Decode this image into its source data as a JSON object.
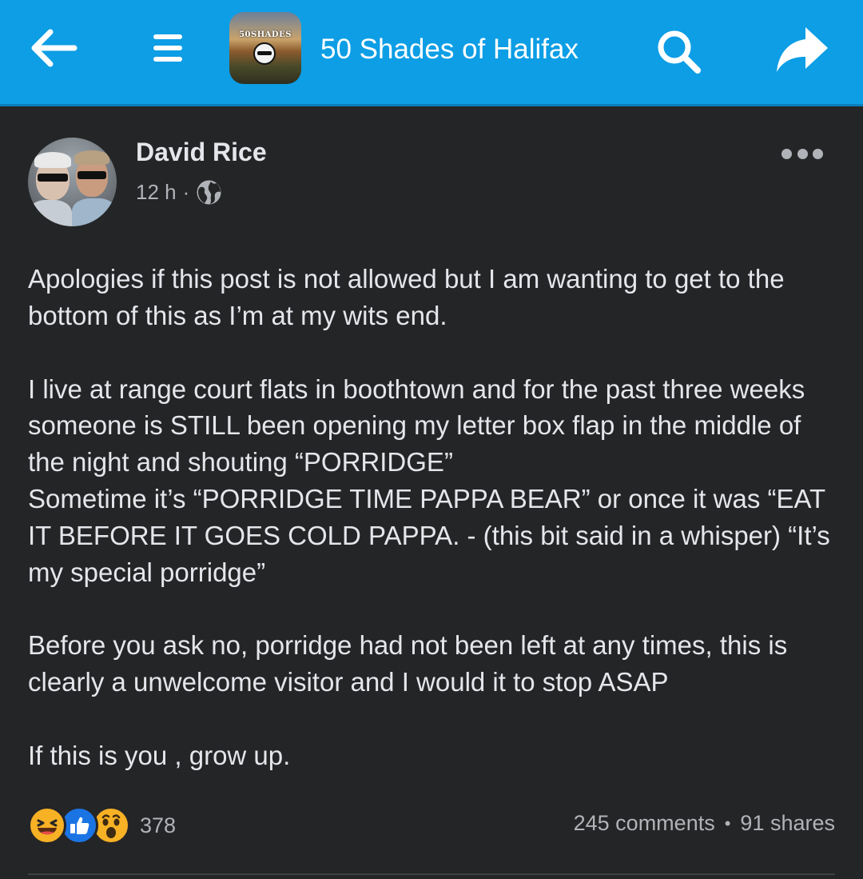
{
  "header": {
    "group_name": "50 Shades of Halifax",
    "group_avatar_text": "50SHADES",
    "background_color": "#0d9ee5",
    "icons": {
      "back": "arrow-left-icon",
      "menu": "hamburger-menu-icon",
      "search": "search-icon",
      "share": "share-arrow-icon"
    }
  },
  "post": {
    "author": "David Rice",
    "time": "12 h",
    "meta_separator": "·",
    "privacy_icon": "globe-icon",
    "body": {
      "p1": "Apologies if this post is not allowed but I am wanting to get to the bottom of this as I’m at my wits end.",
      "p2": "I live at range court flats in boothtown and for the past three weeks someone is STILL been opening my letter box flap in the middle of the night and shouting “PORRIDGE”\nSometime it’s “PORRIDGE TIME PAPPA BEAR” or once it was “EAT IT BEFORE IT GOES COLD PAPPA. - (this bit said in a whisper) “It’s my special porridge”",
      "p3": "Before you ask no, porridge had not been left at any times, this is clearly a unwelcome visitor and I would it to stop ASAP",
      "p4": "If this is you , grow up."
    }
  },
  "footer": {
    "reactions": [
      "haha",
      "like",
      "wow"
    ],
    "reaction_count": "378",
    "comments": "245 comments",
    "separator": "•",
    "shares": "91 shares"
  },
  "colors": {
    "page_background": "#242526",
    "primary_text": "#e4e6eb",
    "secondary_text": "#b0b3b8",
    "like_blue": "#1b74e4",
    "reaction_yellow": "#f7b125"
  }
}
